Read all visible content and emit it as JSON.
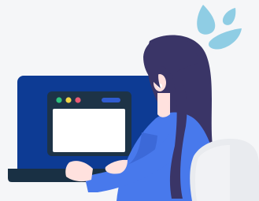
{
  "illustration": {
    "subject": "woman-working-on-laptop",
    "icons": [
      "sweat-drops-icon",
      "laptop-icon",
      "browser-window-icon"
    ],
    "colors": {
      "background": "#f5f6f8",
      "laptop_body": "#0d3b94",
      "laptop_base": "#193044",
      "window_frame": "#1d3347",
      "window_content": "#ffffff",
      "dot_green": "#2ec27e",
      "dot_yellow": "#f2d545",
      "dot_red": "#ea5a75",
      "window_bar": "#2f5bd0",
      "hair": "#3a3567",
      "skin": "#ffe1de",
      "shirt": "#4879ec",
      "sleeve_shade": "#3c69d8",
      "chair": "#e9ebef",
      "sweat": "#8fcde4"
    }
  }
}
